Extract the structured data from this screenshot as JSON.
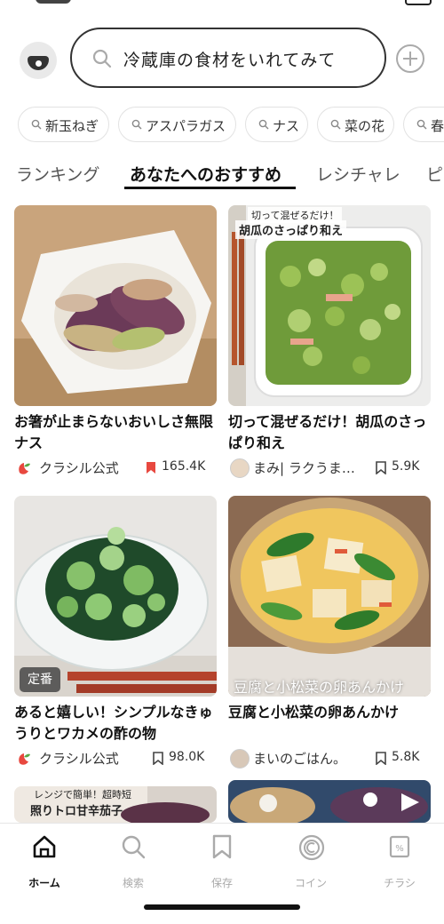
{
  "search": {
    "placeholder": "冷蔵庫の食材をいれてみて"
  },
  "chips": [
    "新玉ねぎ",
    "アスパラガス",
    "ナス",
    "菜の花",
    "春"
  ],
  "tabs": [
    "ランキング",
    "あなたへのおすすめ",
    "レシチャレ",
    "ピ"
  ],
  "active_tab": "あなたへのおすすめ",
  "cards": [
    {
      "title": "お箸が止まらないおいしさ無限ナス",
      "source": "クラシル公式",
      "count": "165.4K",
      "overlay": ""
    },
    {
      "title": "切って混ぜるだけ！胡瓜のさっぱり和え",
      "source": "まみ| ラクうま…",
      "count": "5.9K",
      "overlay": "切って混ぜるだけ！",
      "overlay2": "胡瓜のさっぱり和え"
    },
    {
      "title": "あると嬉しい！シンプルなきゅうりとワカメの酢の物",
      "source": "クラシル公式",
      "count": "98.0K",
      "badge": "定番"
    },
    {
      "title": "豆腐と小松菜の卵あんかけ",
      "source": "まいのごはん。",
      "count": "5.8K",
      "overlay": "豆腐と小松菜の卵あんかけ"
    },
    {
      "overlay": "レンジで簡単！超時短",
      "overlay2": "照りトロ甘辛茄子"
    }
  ],
  "nav": [
    {
      "label": "ホーム",
      "icon": "home-icon",
      "active": true
    },
    {
      "label": "検索",
      "icon": "search-icon"
    },
    {
      "label": "保存",
      "icon": "bookmark-icon"
    },
    {
      "label": "コイン",
      "icon": "coin-icon"
    },
    {
      "label": "チラシ",
      "icon": "flyer-icon"
    }
  ],
  "colors": {
    "accent": "#e8483f",
    "text": "#222222",
    "muted": "#aaaaaa"
  }
}
